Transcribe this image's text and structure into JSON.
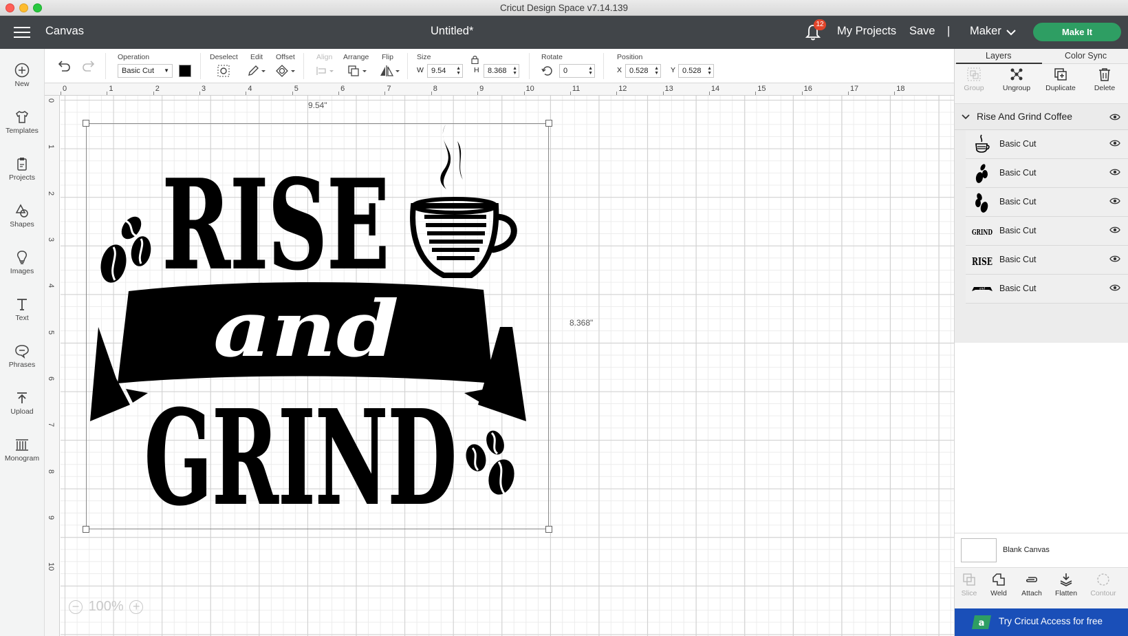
{
  "window": {
    "title": "Cricut Design Space  v7.14.139"
  },
  "header": {
    "section": "Canvas",
    "doc_title": "Untitled*",
    "notifications": "12",
    "my_projects": "My Projects",
    "save": "Save",
    "divider": "|",
    "machine": "Maker",
    "make_it": "Make It"
  },
  "sidebar": {
    "items": [
      {
        "label": "New",
        "icon": "plus-circle-icon"
      },
      {
        "label": "Templates",
        "icon": "shirt-icon"
      },
      {
        "label": "Projects",
        "icon": "clipboard-icon"
      },
      {
        "label": "Shapes",
        "icon": "shapes-icon"
      },
      {
        "label": "Images",
        "icon": "bulb-icon"
      },
      {
        "label": "Text",
        "icon": "text-icon"
      },
      {
        "label": "Phrases",
        "icon": "chat-icon"
      },
      {
        "label": "Upload",
        "icon": "upload-icon"
      },
      {
        "label": "Monogram",
        "icon": "monogram-icon"
      }
    ]
  },
  "toolbar": {
    "operation_label": "Operation",
    "operation_value": "Basic Cut",
    "operation_color": "#000000",
    "deselect_label": "Deselect",
    "edit_label": "Edit",
    "offset_label": "Offset",
    "align_label": "Align",
    "arrange_label": "Arrange",
    "flip_label": "Flip",
    "size_label": "Size",
    "w_label": "W",
    "w_value": "9.54",
    "h_label": "H",
    "h_value": "8.368",
    "rotate_label": "Rotate",
    "rotate_value": "0",
    "position_label": "Position",
    "x_label": "X",
    "x_value": "0.528",
    "y_label": "Y",
    "y_value": "0.528"
  },
  "rulers": {
    "top": [
      "0",
      "1",
      "2",
      "3",
      "4",
      "5",
      "6",
      "7",
      "8",
      "9",
      "10",
      "11",
      "12",
      "13",
      "14",
      "15",
      "16",
      "17",
      "18"
    ],
    "left": [
      "0",
      "1",
      "2",
      "3",
      "4",
      "5",
      "6",
      "7",
      "8",
      "9",
      "10"
    ]
  },
  "canvas": {
    "width_label": "9.54\"",
    "height_label": "8.368\"",
    "zoom": "100%",
    "design_words": {
      "rise": "RISE",
      "and": "and",
      "grind": "GRIND"
    }
  },
  "right_panel": {
    "tabs": [
      "Layers",
      "Color Sync"
    ],
    "actions": [
      {
        "label": "Group",
        "enabled": false
      },
      {
        "label": "Ungroup",
        "enabled": true
      },
      {
        "label": "Duplicate",
        "enabled": true
      },
      {
        "label": "Delete",
        "enabled": true
      }
    ],
    "group_name": "Rise And Grind Coffee",
    "layers": [
      {
        "name": "Basic Cut",
        "thumb": "cup"
      },
      {
        "name": "Basic Cut",
        "thumb": "beans"
      },
      {
        "name": "Basic Cut",
        "thumb": "beans"
      },
      {
        "name": "Basic Cut",
        "thumb": "GRIND"
      },
      {
        "name": "Basic Cut",
        "thumb": "RISE"
      },
      {
        "name": "Basic Cut",
        "thumb": "and"
      }
    ],
    "blank_canvas": "Blank Canvas",
    "bottom_actions": [
      {
        "label": "Slice",
        "enabled": false
      },
      {
        "label": "Weld",
        "enabled": true
      },
      {
        "label": "Attach",
        "enabled": true
      },
      {
        "label": "Flatten",
        "enabled": true
      },
      {
        "label": "Contour",
        "enabled": false
      }
    ],
    "access_cta": "Try Cricut Access for free"
  },
  "colors": {
    "header_bg": "#414549",
    "make_it": "#2e9e63",
    "access_bg": "#1a4fb8",
    "badge": "#e2452b"
  }
}
